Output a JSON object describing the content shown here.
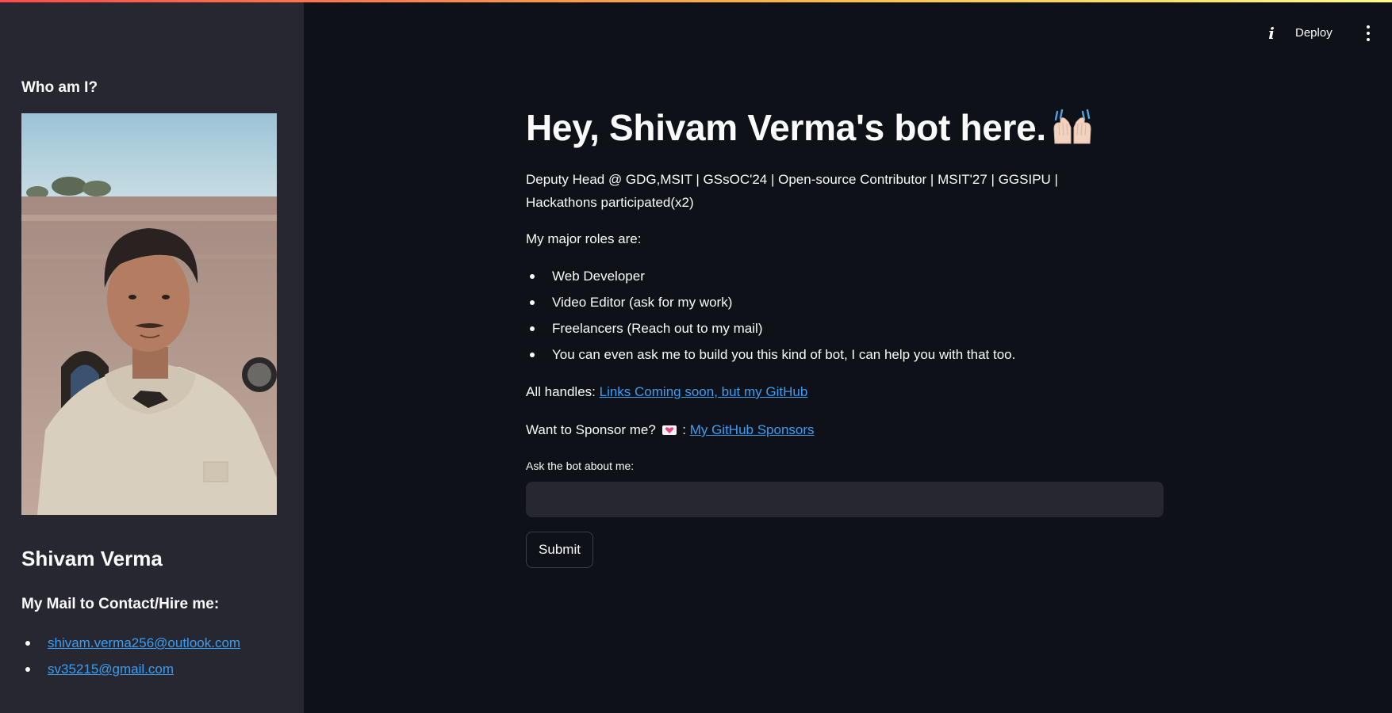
{
  "theme": {
    "background": "#0e1117",
    "sidebar_background": "#262730",
    "text": "#fafafa",
    "link": "#3d9df3",
    "top_gradient": [
      "#ff4b4b",
      "#ffbd45",
      "#fffd80"
    ]
  },
  "header": {
    "info_icon": "info-icon",
    "deploy_label": "Deploy",
    "menu_icon": "kebab-menu-icon"
  },
  "sidebar": {
    "heading": "Who am I?",
    "photo_icon": "profile-photo",
    "name": "Shivam Verma",
    "contact_heading": "My Mail to Contact/Hire me:",
    "emails": [
      "shivam.verma256@outlook.com",
      "sv35215@gmail.com"
    ]
  },
  "main": {
    "title": "Hey, Shivam Verma's bot here.",
    "title_emoji": "raising-hands-emoji",
    "intro": "Deputy Head @ GDG,MSIT | GSsOC'24 | Open-source Contributor | MSIT'27 | GGSIPU | Hackathons participated(x2)",
    "roles_intro": "My major roles are:",
    "roles": [
      "Web Developer",
      "Video Editor (ask for my work)",
      "Freelancers (Reach out to my mail)",
      "You can even ask me to build you this kind of bot, I can help you with that too."
    ],
    "handles_label": "All handles: ",
    "handles_link": "Links Coming soon, but my GitHub",
    "sponsor_label": "Want to Sponsor me? ",
    "sponsor_icon": "heart-letter-icon",
    "sponsor_sep": " : ",
    "sponsor_link": "My GitHub Sponsors",
    "input_label": "Ask the bot about me:",
    "input_value": "",
    "input_placeholder": "",
    "submit_label": "Submit"
  }
}
